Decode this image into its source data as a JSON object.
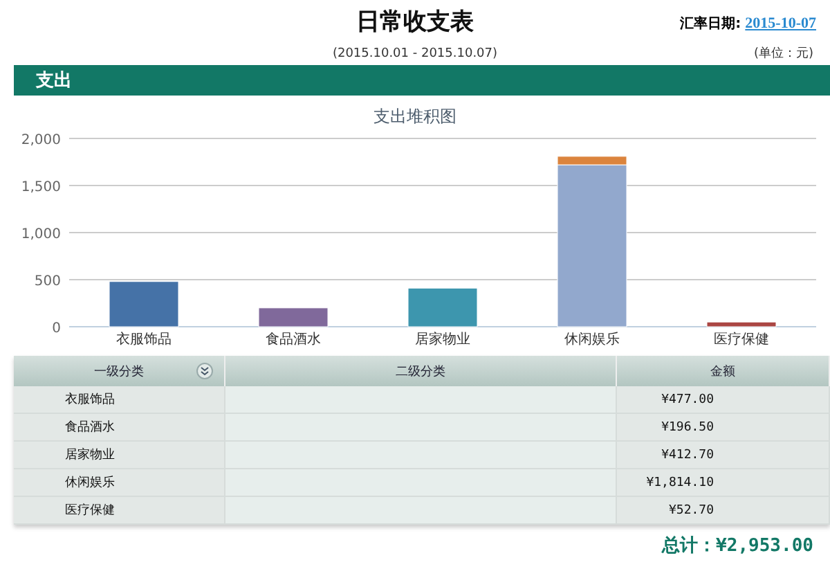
{
  "title": "日常收支表",
  "rate_date": {
    "label": "汇率日期:",
    "value": "2015-10-07"
  },
  "period": "(2015.10.01 - 2015.10.07)",
  "unit": "(单位：元)",
  "section": {
    "title": "支出"
  },
  "chart_data": {
    "type": "bar",
    "stacked": true,
    "grid": true,
    "title": "支出堆积图",
    "categories": [
      "衣服饰品",
      "食品酒水",
      "居家物业",
      "休闲娱乐",
      "医疗保健"
    ],
    "ylim": [
      0,
      2000
    ],
    "yticks": [
      {
        "value": 0,
        "label": "0"
      },
      {
        "value": 500,
        "label": "500"
      },
      {
        "value": 1000,
        "label": "1,000"
      },
      {
        "value": 1500,
        "label": "1,500"
      },
      {
        "value": 2000,
        "label": "2,000"
      }
    ],
    "series": [
      {
        "color": "#4572a7",
        "values": [
          480,
          null,
          null,
          null,
          null
        ]
      },
      {
        "color": "#80699b",
        "values": [
          null,
          200,
          null,
          null,
          null
        ]
      },
      {
        "color": "#3d96ae",
        "values": [
          null,
          null,
          410,
          null,
          null
        ]
      },
      {
        "color": "#92a8cd",
        "values": [
          null,
          null,
          null,
          1720,
          null
        ]
      },
      {
        "color": "#db843d",
        "values": [
          null,
          null,
          null,
          90,
          null
        ]
      },
      {
        "color": "#aa4643",
        "values": [
          null,
          null,
          null,
          null,
          50
        ]
      }
    ]
  },
  "table": {
    "columns": [
      "一级分类",
      "二级分类",
      "金额"
    ],
    "rows": [
      {
        "category": "衣服饰品",
        "amount": "¥477.00"
      },
      {
        "category": "食品酒水",
        "amount": "¥196.50"
      },
      {
        "category": "居家物业",
        "amount": "¥412.70"
      },
      {
        "category": "休闲娱乐",
        "amount": "¥1,814.10"
      },
      {
        "category": "医疗保健",
        "amount": "¥52.70"
      }
    ]
  },
  "total": "总计：¥2,953.00"
}
